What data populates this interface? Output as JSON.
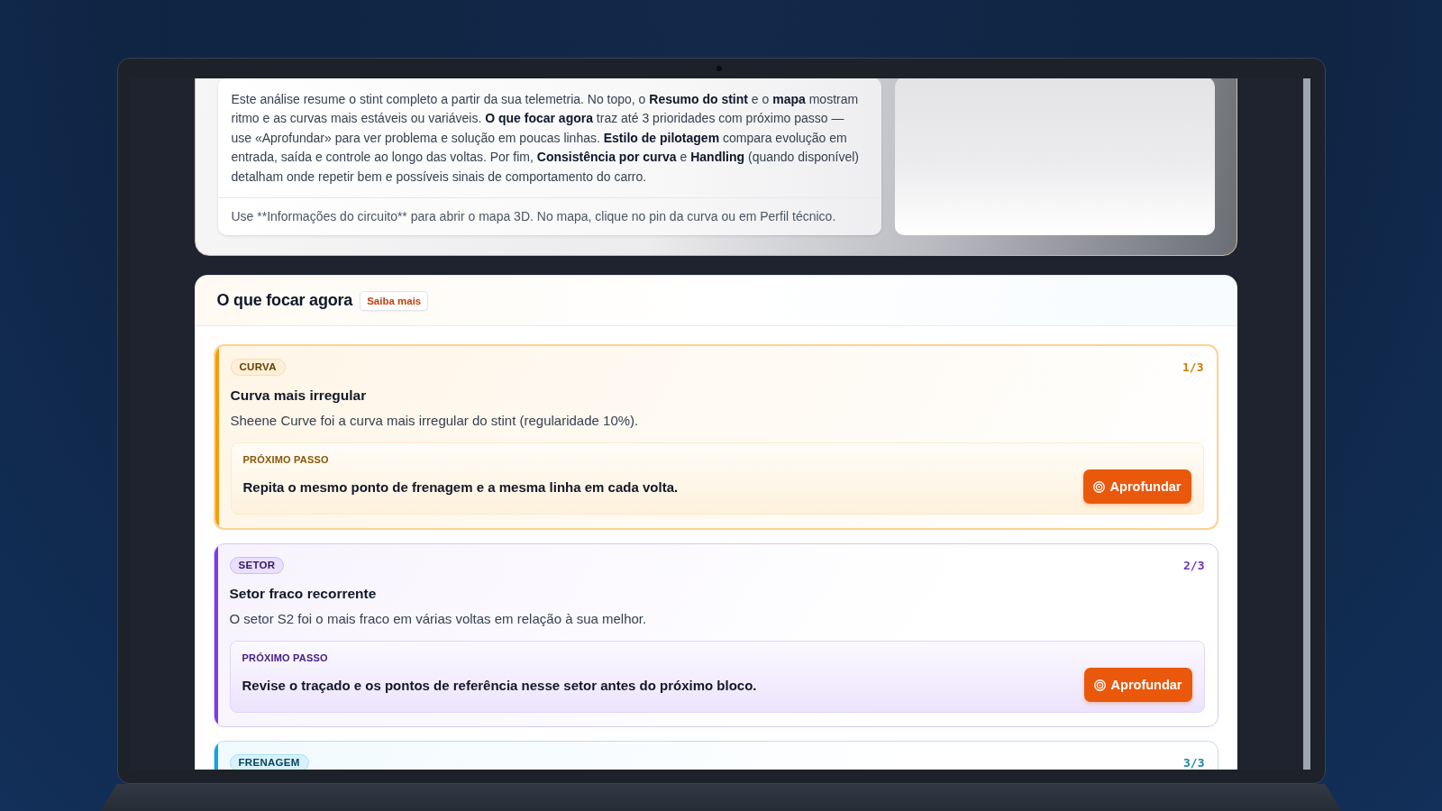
{
  "intro": {
    "text": "Este análise resume o stint completo a partir da sua telemetria. No topo, o **Resumo do stint** e o **mapa** mostram ritmo e as curvas mais estáveis ou variáveis. **O que focar agora** traz até 3 prioridades com próximo passo — use «Aprofundar» para ver problema e solução em poucas linhas. **Estilo de pilotagem** compara evolução em entrada, saída e controle ao longo das voltas. Por fim, **Consistência por curva** e **Handling** (quando disponível) detalham onde repetir bem e possíveis sinais de comportamento do carro.",
    "footnote": "Use **Informações do circuito** para abrir o mapa 3D. No mapa, clique no pin da curva ou em Perfil técnico."
  },
  "priorities": {
    "title": "O que focar agora",
    "learn_more": "Saiba mais",
    "items": [
      {
        "tag": "CURVA",
        "counter": "1/3",
        "color": "#f59e0b",
        "highlighted": true,
        "title": "Curva mais irregular",
        "description": "Sheene Curve foi a curva mais irregular do stint (regularidade 10%).",
        "next_step": {
          "label": "PRÓXIMO PASSO",
          "text": "Repita o mesmo ponto de frenagem e a mesma linha em cada volta.",
          "button": "Aprofundar"
        }
      },
      {
        "tag": "SETOR",
        "counter": "2/3",
        "color": "#7c3aed",
        "highlighted": false,
        "title": "Setor fraco recorrente",
        "description": "O setor S2 foi o mais fraco em várias voltas em relação à sua melhor.",
        "next_step": {
          "label": "PRÓXIMO PASSO",
          "text": "Revise o traçado e os pontos de referência nesse setor antes do próximo bloco.",
          "button": "Aprofundar"
        }
      },
      {
        "tag": "FRENAGEM",
        "counter": "3/3",
        "color": "#0ea5e9",
        "highlighted": false
      }
    ]
  }
}
